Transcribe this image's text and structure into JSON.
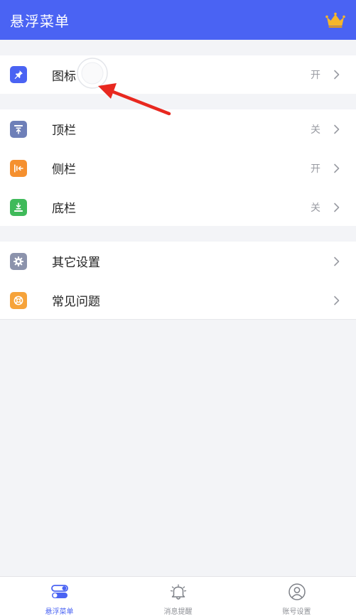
{
  "header": {
    "title": "悬浮菜单",
    "crown_icon": "crown-icon"
  },
  "groups": [
    {
      "items": [
        {
          "label": "图标",
          "value": "开",
          "icon": "pin-icon",
          "color": "#4a63f3"
        }
      ]
    },
    {
      "items": [
        {
          "label": "顶栏",
          "value": "关",
          "icon": "top-bar-icon",
          "color": "#6e7fb8"
        },
        {
          "label": "侧栏",
          "value": "开",
          "icon": "side-bar-icon",
          "color": "#f5902f"
        },
        {
          "label": "底栏",
          "value": "关",
          "icon": "bottom-bar-icon",
          "color": "#3fba5a"
        }
      ]
    },
    {
      "items": [
        {
          "label": "其它设置",
          "value": "",
          "icon": "gear-icon",
          "color": "#8c93ac"
        },
        {
          "label": "常见问题",
          "value": "",
          "icon": "lifebuoy-icon",
          "color": "#f6a33a"
        }
      ]
    }
  ],
  "bottom_nav": {
    "items": [
      {
        "label": "悬浮菜单",
        "icon": "toggle-icon",
        "active": true
      },
      {
        "label": "消息提醒",
        "icon": "bell-icon",
        "active": false
      },
      {
        "label": "账号设置",
        "icon": "user-icon",
        "active": false
      }
    ]
  },
  "colors": {
    "primary": "#4a63f3",
    "background": "#f3f4f7",
    "annotation_arrow": "#e8281f"
  }
}
